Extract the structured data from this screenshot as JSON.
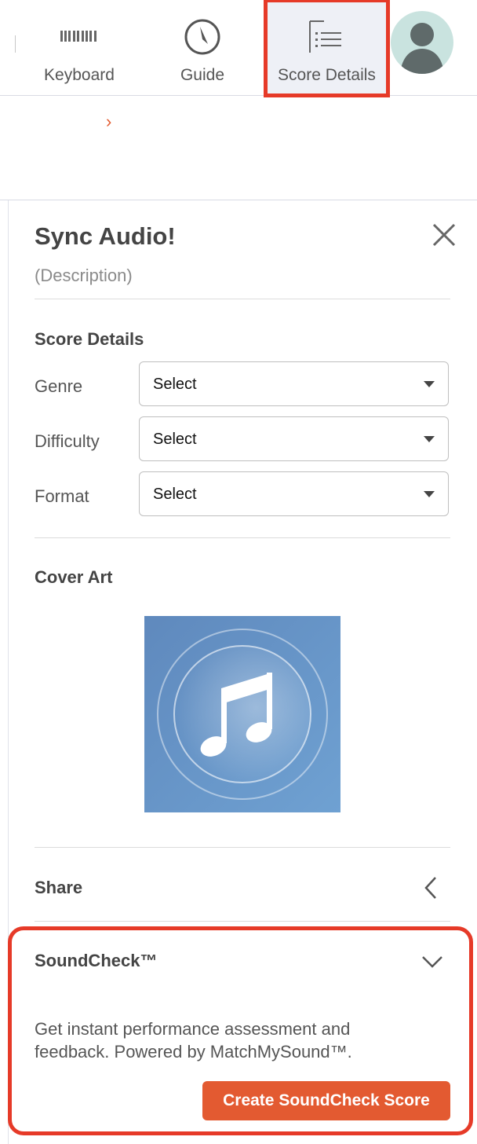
{
  "toolbar": {
    "items": [
      {
        "label": "Keyboard",
        "icon": "piano-keys-icon"
      },
      {
        "label": "Guide",
        "icon": "compass-icon"
      },
      {
        "label": "Score Details",
        "icon": "list-icon",
        "selected": true
      }
    ],
    "highlight_color": "#e63a28"
  },
  "breadcrumb": {
    "chevron": "›",
    "chevron_color": "#e35a2e"
  },
  "panel": {
    "title": "Sync Audio!",
    "description": "(Description)",
    "close_icon": "close-icon",
    "score_details": {
      "heading": "Score Details",
      "fields": [
        {
          "label": "Genre",
          "value": "Select"
        },
        {
          "label": "Difficulty",
          "value": "Select"
        },
        {
          "label": "Format",
          "value": "Select"
        }
      ]
    },
    "cover_art": {
      "heading": "Cover Art",
      "icon": "music-note-icon",
      "bg_color": "#6a9bcc"
    },
    "share": {
      "heading": "Share",
      "icon": "chevron-left-icon"
    },
    "soundcheck": {
      "heading": "SoundCheck™",
      "icon": "chevron-down-icon",
      "description": "Get instant performance assessment and feedback. Powered by MatchMySound™.",
      "button_label": "Create SoundCheck Score",
      "button_color": "#e35a31"
    }
  }
}
